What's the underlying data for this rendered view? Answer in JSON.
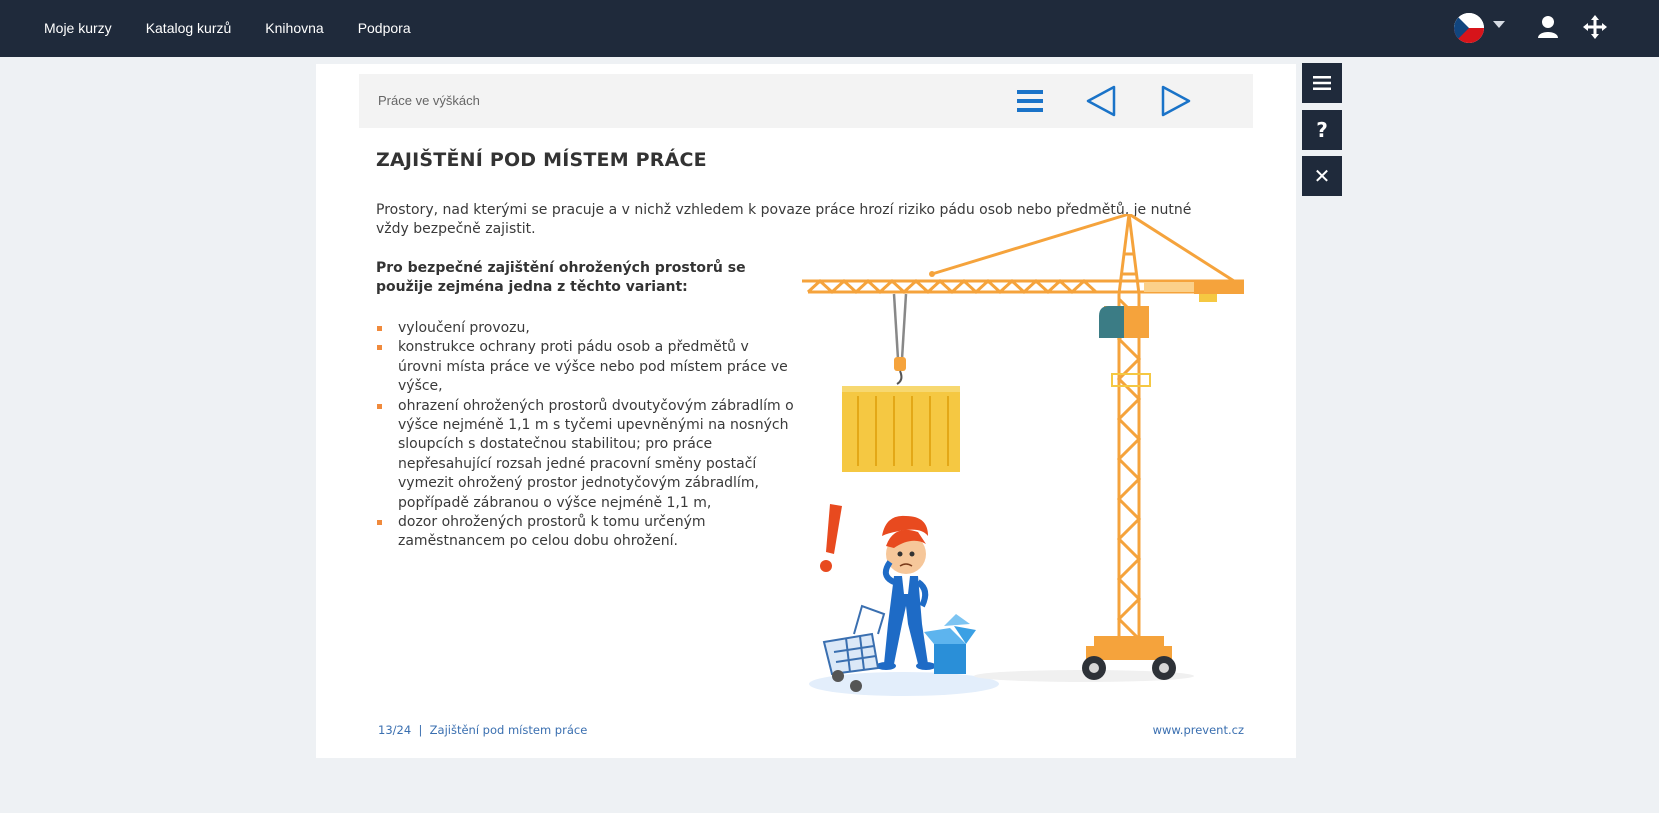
{
  "nav": {
    "items": [
      {
        "label": "Moje kurzy"
      },
      {
        "label": "Katalog kurzů"
      },
      {
        "label": "Knihovna"
      },
      {
        "label": "Podpora"
      }
    ]
  },
  "topbar": {
    "language_icon": "czech-flag-icon",
    "user_icon": "user-icon",
    "move_icon": "move-arrows-icon"
  },
  "lesson": {
    "course_title": "Práce ve výškách",
    "heading": "ZAJIŠTĚNÍ POD MÍSTEM PRÁCE",
    "intro": "Prostory, nad kterými se pracuje a v nichž vzhledem k povaze práce hrozí riziko pádu osob nebo předmětů, je nutné vždy bezpečně zajistit.",
    "subheading": "Pro bezpečné zajištění ohrožených prostorů se použije zejména jedna z těchto variant:",
    "bullets": [
      "vyloučení provozu,",
      "konstrukce ochrany proti pádu osob a předmětů v úrovni místa práce ve výšce nebo pod místem práce ve výšce,",
      "ohrazení ohrožených prostorů dvoutyčovým zábradlím o výšce nejméně 1,1 m s tyčemi upevněnými na nosných sloupcích s dostatečnou stabilitou; pro práce nepřesahující rozsah jedné pracovní směny postačí vymezit ohrožený prostor jednotyčovým zábradlím, popřípadě zábranou o výšce nejméně 1,1 m,",
      "dozor ohrožených prostorů k tomu určeným zaměstnancem po celou dobu ohrožení."
    ],
    "footer_page": "13/24",
    "footer_separator": "|",
    "footer_section": "Zajištění pod místem práce",
    "footer_site": "www.prevent.cz"
  },
  "colors": {
    "topbar": "#1f2a3b",
    "accent_blue": "#1a73c8",
    "bullet_orange": "#f08a3c",
    "crane_orange": "#f5a33c"
  },
  "side": {
    "menu_icon": "hamburger-icon",
    "help_label": "?",
    "close_label": "✕"
  }
}
